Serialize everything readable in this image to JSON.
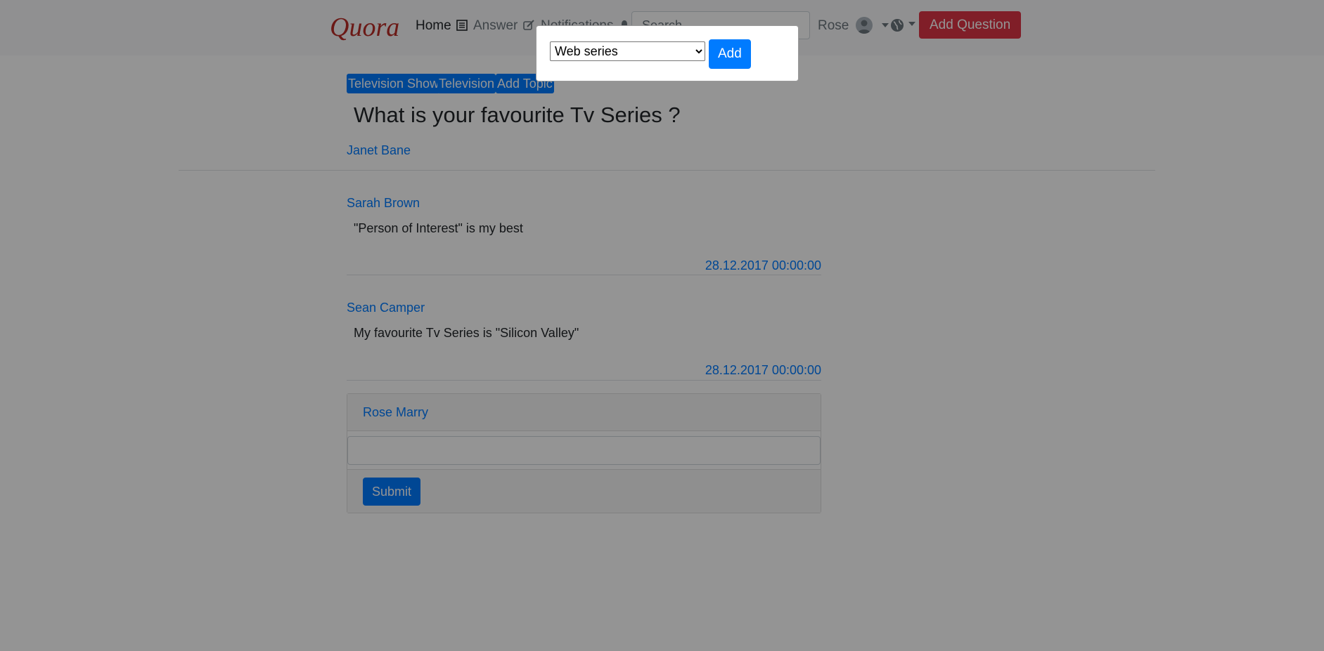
{
  "navbar": {
    "logo": "Quora",
    "home_label": "Home",
    "answer_label": "Answer",
    "notifications_label": "Notifications",
    "search_placeholder": "Search",
    "user_name": "Rose",
    "add_question_label": "Add Question",
    "icons": [
      "newspaper-icon",
      "edit-icon",
      "bell-icon",
      "user-avatar-icon",
      "globe-icon",
      "caret-down-icon"
    ]
  },
  "question": {
    "topics": [
      "Television Show",
      "Television"
    ],
    "add_topic_label": "Add Topic",
    "title": "What is your favourite Tv Series ?",
    "asker": "Janet Bane"
  },
  "answers": [
    {
      "author": "Sarah Brown",
      "text": "\"Person of Interest\" is my best",
      "date": "28.12.2017 00:00:00"
    },
    {
      "author": "Sean Camper",
      "text": "My favourite Tv Series is \"Silicon Valley\"",
      "date": "28.12.2017 00:00:00"
    }
  ],
  "answer_form": {
    "user": "Rose Marry",
    "input_value": "",
    "submit_label": "Submit"
  },
  "modal": {
    "selected_topic": "Web series",
    "add_label": "Add"
  },
  "colors": {
    "brand": "#b92b27",
    "primary": "#007bff",
    "danger": "#dc3545",
    "overlay": "rgba(0,0,0,0.42)"
  }
}
